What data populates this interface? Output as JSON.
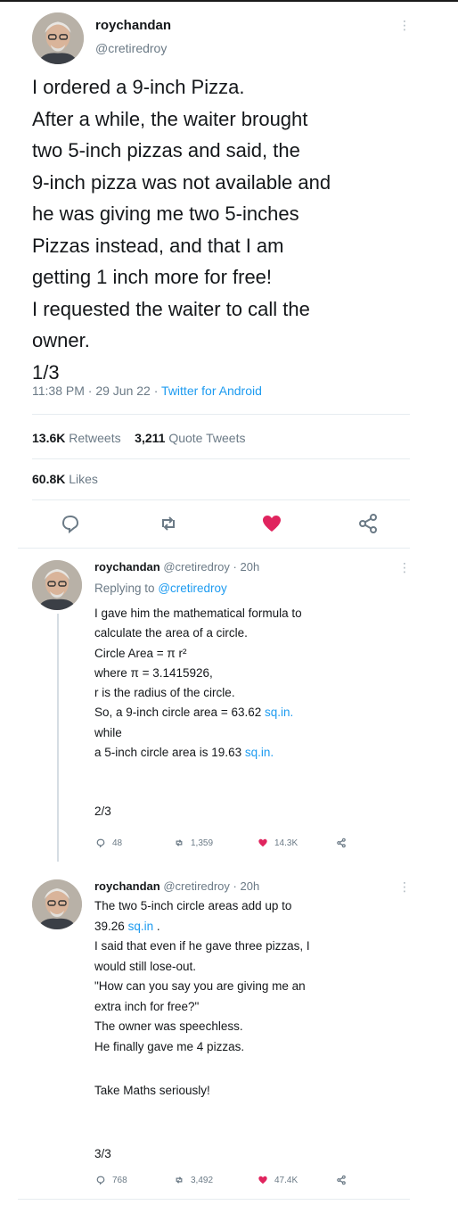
{
  "colors": {
    "link": "#1d9bf0",
    "like": "#e0245e",
    "muted": "#6b7a86"
  },
  "main_tweet": {
    "author_name": "roychandan",
    "author_handle": "@cretiredroy",
    "lines": [
      "I ordered a 9-inch Pizza.",
      "After a while, the waiter  brought",
      "two 5-inch pizzas and said, the",
      "9-inch pizza was not available and",
      "he was giving me two 5-inches",
      "Pizzas instead, and that I am",
      "getting 1 inch more for free!",
      "I requested  the waiter to call the",
      "owner.",
      "1/3"
    ],
    "time": "11:38 PM",
    "date": "29 Jun 22",
    "client": "Twitter for Android",
    "retweets_count": "13.6K",
    "retweets_label": "Retweets",
    "quotes_count": "3,211",
    "quotes_label": "Quote Tweets",
    "likes_count": "60.8K",
    "likes_label": "Likes",
    "action_icons": [
      "reply-icon",
      "retweet-icon",
      "like-icon-filled",
      "share-icon"
    ]
  },
  "reply_1": {
    "author_name": "roychandan",
    "author_handle": "@cretiredroy",
    "age": "20h",
    "replying_prefix": "Replying to",
    "replying_handle": "@cretiredroy",
    "lines": [
      "I gave him the  mathematical formula to",
      "calculate the area of a circle.",
      "Circle Area = π r²",
      "where π = 3.1415926,",
      "r is the radius of the circle.",
      "So, a 9-inch circle area = 63.62",
      "while",
      "a 5-inch circle area is 19.63"
    ],
    "unit": "sq.in.",
    "page": "2/3",
    "replies": "48",
    "retweets": "1,359",
    "likes": "14.3K"
  },
  "reply_2": {
    "author_name": "roychandan",
    "author_handle": "@cretiredroy",
    "age": "20h",
    "lines": [
      "The two 5-inch circle areas add up to",
      "39.26",
      "I said that even if he gave three pizzas, I",
      "would still lose-out.",
      "\"How can you say you are giving me an",
      "extra inch for free?\"",
      "The owner was speechless.",
      "He finally gave me 4 pizzas.",
      "",
      "Take Maths seriously!"
    ],
    "unit": "sq.in",
    "page": "3/3",
    "replies": "768",
    "retweets": "3,492",
    "likes": "47.4K"
  }
}
